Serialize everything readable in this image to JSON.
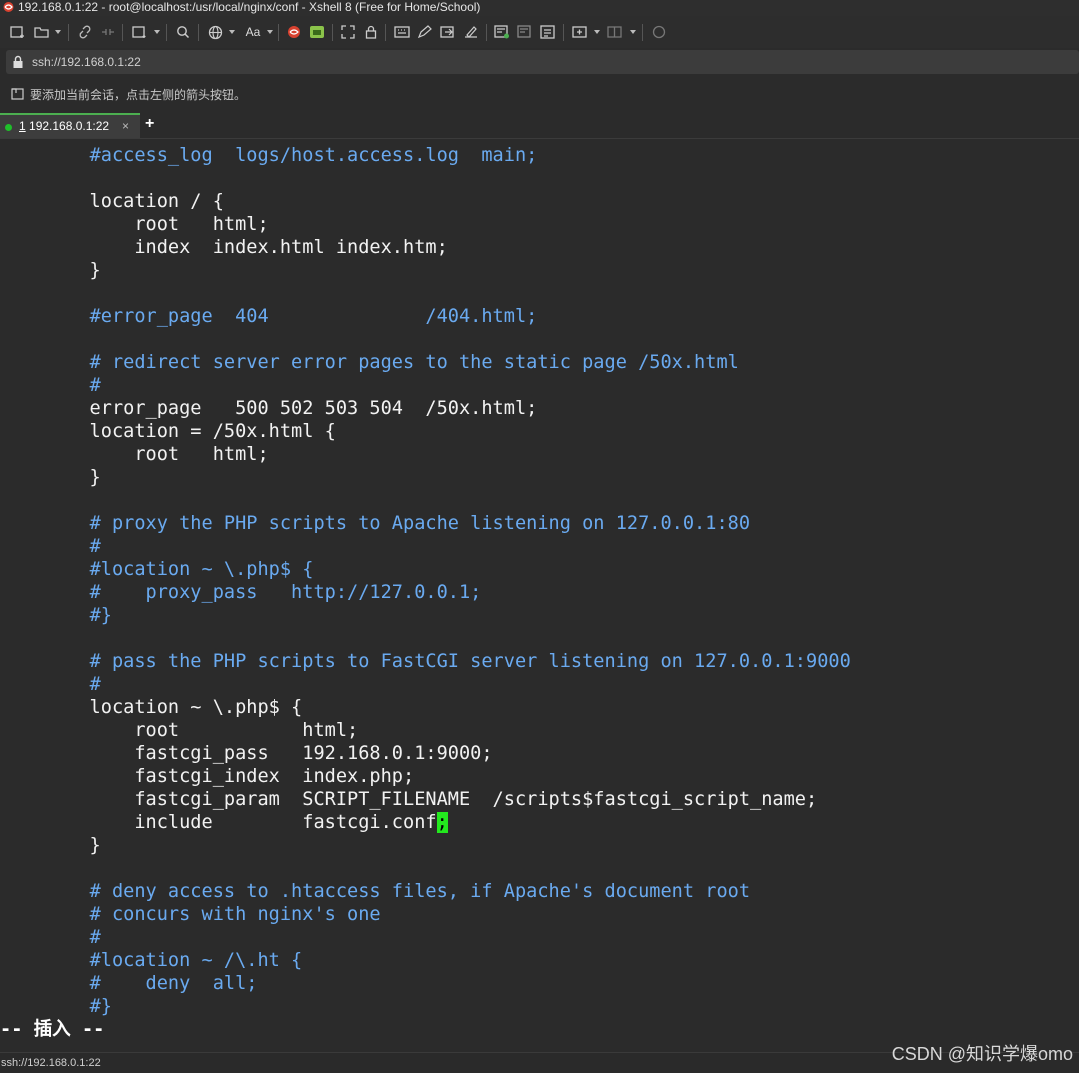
{
  "window": {
    "title": "192.168.0.1:22 - root@localhost:/usr/local/nginx/conf - Xshell 8 (Free for Home/School)"
  },
  "address_bar": {
    "value": "ssh://192.168.0.1:22"
  },
  "hint_bar": {
    "text": "要添加当前会话，点击左侧的箭头按钮。"
  },
  "tabs": [
    {
      "number": "1",
      "label": " 192.168.0.1:22",
      "close": "×"
    }
  ],
  "new_tab": "+",
  "terminal": {
    "lines": [
      [
        {
          "t": "        "
        },
        {
          "t": "#access_log  logs/host.access.log  main;",
          "c": 1
        }
      ],
      [],
      [
        {
          "t": "        location / {"
        }
      ],
      [
        {
          "t": "            root   html;"
        }
      ],
      [
        {
          "t": "            index  index.html index.htm;"
        }
      ],
      [
        {
          "t": "        }"
        }
      ],
      [],
      [
        {
          "t": "        "
        },
        {
          "t": "#error_page  404              /404.html;",
          "c": 1
        }
      ],
      [],
      [
        {
          "t": "        "
        },
        {
          "t": "# redirect server error pages to the static page /50x.html",
          "c": 1
        }
      ],
      [
        {
          "t": "        "
        },
        {
          "t": "#",
          "c": 1
        }
      ],
      [
        {
          "t": "        error_page   500 502 503 504  /50x.html;"
        }
      ],
      [
        {
          "t": "        location = /50x.html {"
        }
      ],
      [
        {
          "t": "            root   html;"
        }
      ],
      [
        {
          "t": "        }"
        }
      ],
      [],
      [
        {
          "t": "        "
        },
        {
          "t": "# proxy the PHP scripts to Apache listening on 127.0.0.1:80",
          "c": 1
        }
      ],
      [
        {
          "t": "        "
        },
        {
          "t": "#",
          "c": 1
        }
      ],
      [
        {
          "t": "        "
        },
        {
          "t": "#location ~ \\.php$ {",
          "c": 1
        }
      ],
      [
        {
          "t": "        "
        },
        {
          "t": "#    proxy_pass   http://127.0.0.1;",
          "c": 1
        }
      ],
      [
        {
          "t": "        "
        },
        {
          "t": "#}",
          "c": 1
        }
      ],
      [],
      [
        {
          "t": "        "
        },
        {
          "t": "# pass the PHP scripts to FastCGI server listening on 127.0.0.1:9000",
          "c": 1
        }
      ],
      [
        {
          "t": "        "
        },
        {
          "t": "#",
          "c": 1
        }
      ],
      [
        {
          "t": "        location ~ \\.php$ {"
        }
      ],
      [
        {
          "t": "            root           html;"
        }
      ],
      [
        {
          "t": "            fastcgi_pass   192.168.0.1:9000;"
        }
      ],
      [
        {
          "t": "            fastcgi_index  index.php;"
        }
      ],
      [
        {
          "t": "            fastcgi_param  SCRIPT_FILENAME  /scripts$fastcgi_script_name;"
        }
      ],
      [
        {
          "t": "            include        fastcgi.conf"
        },
        {
          "t": ";",
          "cur": 1
        }
      ],
      [
        {
          "t": "        }"
        }
      ],
      [],
      [
        {
          "t": "        "
        },
        {
          "t": "# deny access to .htaccess files, if Apache's document root",
          "c": 1
        }
      ],
      [
        {
          "t": "        "
        },
        {
          "t": "# concurs with nginx's one",
          "c": 1
        }
      ],
      [
        {
          "t": "        "
        },
        {
          "t": "#",
          "c": 1
        }
      ],
      [
        {
          "t": "        "
        },
        {
          "t": "#location ~ /\\.ht {",
          "c": 1
        }
      ],
      [
        {
          "t": "        "
        },
        {
          "t": "#    deny  all;",
          "c": 1
        }
      ],
      [
        {
          "t": "        "
        },
        {
          "t": "#}",
          "c": 1
        }
      ]
    ],
    "mode_line": "-- 插入 --"
  },
  "status_bar": {
    "text": "ssh://192.168.0.1:22"
  },
  "watermark": "CSDN @知识学爆omo",
  "colors": {
    "comment": "#6aaaf0",
    "cursor": "#23e81e",
    "background": "#2b2b2b",
    "tab_active_dot": "#1fbf2a"
  },
  "toolbar_icons": [
    "new-session-icon",
    "open-folder-icon",
    "link-icon",
    "unlink-icon",
    "new-window-icon",
    "search-icon",
    "globe-icon",
    "font-icon",
    "xftp-icon",
    "xshell-icon",
    "fullscreen-icon",
    "lock-icon",
    "keyboard-icon",
    "compose-icon",
    "script-icon",
    "pen-icon",
    "terminal-new-icon",
    "transfer-icon",
    "log-icon",
    "add-tab-icon",
    "layout-icon",
    "chat-icon"
  ]
}
